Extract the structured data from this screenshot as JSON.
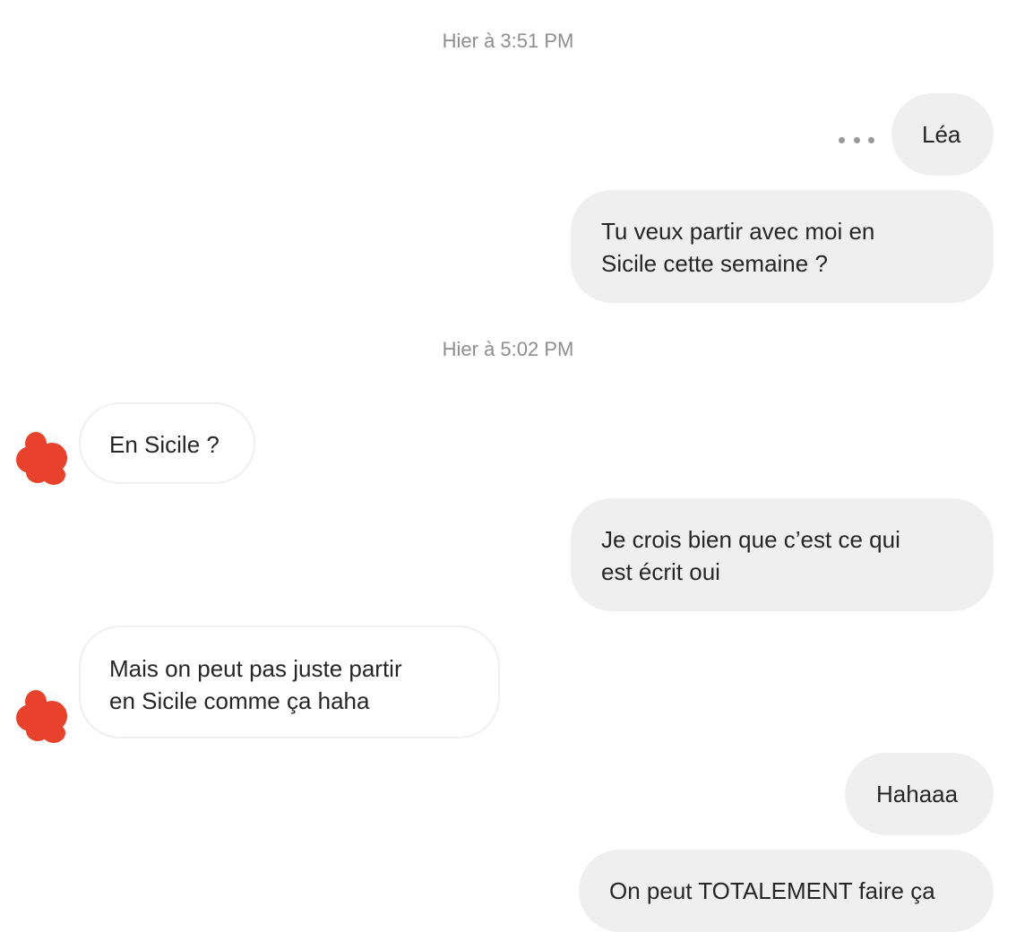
{
  "conversation": {
    "timestamps": [
      "Hier à 3:51 PM",
      "Hier à 5:02 PM"
    ],
    "messages": [
      {
        "from": "me",
        "text": "Léa"
      },
      {
        "from": "me",
        "text": "Tu veux partir avec moi en\nSicile cette semaine ?"
      },
      {
        "from": "them",
        "text": "En Sicile ?"
      },
      {
        "from": "me",
        "text": "Je crois bien que c’est ce qui\nest écrit oui"
      },
      {
        "from": "them",
        "text": "Mais on peut pas juste partir\nen Sicile comme ça haha"
      },
      {
        "from": "me",
        "text": "Hahaaa"
      },
      {
        "from": "me",
        "text": "On peut TOTALEMENT faire ça"
      }
    ]
  },
  "icons": {
    "message_options": "more-horizontal-icon",
    "contact_avatar": "redacted-avatar"
  },
  "colors": {
    "outgoing_bubble": "#efefef",
    "incoming_border": "#efefef",
    "timestamp": "#8e8e8e",
    "avatar_redaction": "#e8412c"
  }
}
